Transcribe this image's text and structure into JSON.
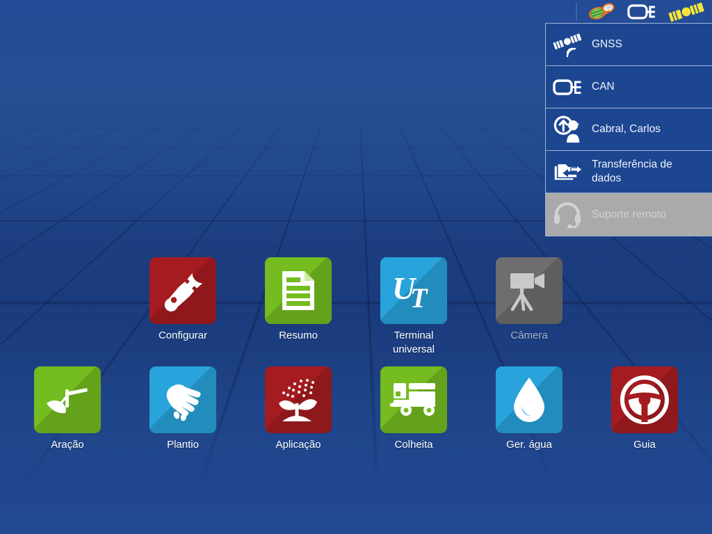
{
  "statusbar": {
    "icons": [
      {
        "name": "brand-leaf-logo",
        "label": "Brand logo"
      },
      {
        "name": "can-bus-icon",
        "label": "CAN"
      },
      {
        "name": "gnss-satellite-icon",
        "label": "GNSS"
      }
    ]
  },
  "menu": {
    "items": [
      {
        "label": "GNSS",
        "icon": "satellite-signal-icon",
        "disabled": false
      },
      {
        "label": "CAN",
        "icon": "can-bus-icon",
        "disabled": false
      },
      {
        "label": "Cabral, Carlos",
        "icon": "operator-login-icon",
        "disabled": false
      },
      {
        "label": "Transferência de\ndados",
        "icon": "data-transfer-folder-icon",
        "disabled": false
      },
      {
        "label": "Suporte remoto",
        "icon": "headset-icon",
        "disabled": true
      }
    ]
  },
  "apps": {
    "row1": [
      {
        "label": "Configurar",
        "icon": "wrench-icon",
        "color": "#a51c20",
        "disabled": false
      },
      {
        "label": "Resumo",
        "icon": "document-icon",
        "color": "#74bc1f",
        "disabled": false
      },
      {
        "label": "Terminal\nuniversal",
        "icon": "ut-icon",
        "color": "#28a3db",
        "disabled": false
      },
      {
        "label": "Câmera",
        "icon": "camera-tripod-icon",
        "color": "#6e6e6e",
        "disabled": true
      }
    ],
    "row2": [
      {
        "label": "Aração",
        "icon": "plow-icon",
        "color": "#74bc1f",
        "disabled": false
      },
      {
        "label": "Plantio",
        "icon": "seeding-hand-icon",
        "color": "#28a3db",
        "disabled": false
      },
      {
        "label": "Aplicação",
        "icon": "spray-plant-icon",
        "color": "#a51c20",
        "disabled": false
      },
      {
        "label": "Colheita",
        "icon": "combine-harvester-icon",
        "color": "#74bc1f",
        "disabled": false
      },
      {
        "label": "Ger. água",
        "icon": "water-drop-icon",
        "color": "#28a3db",
        "disabled": false
      },
      {
        "label": "Guia",
        "icon": "steering-wheel-icon",
        "color": "#a51c20",
        "disabled": false
      }
    ]
  },
  "colors": {
    "background_top": "#2a5398",
    "background_bottom": "#234b92",
    "menu_bg": "#1d4691",
    "menu_border": "#9fb4d6",
    "menu_disabled_bg": "#aaaaaa",
    "red": "#a51c20",
    "green": "#74bc1f",
    "blue": "#28a3db",
    "gray": "#6e6e6e",
    "satellite_yellow": "#f7e43a"
  }
}
